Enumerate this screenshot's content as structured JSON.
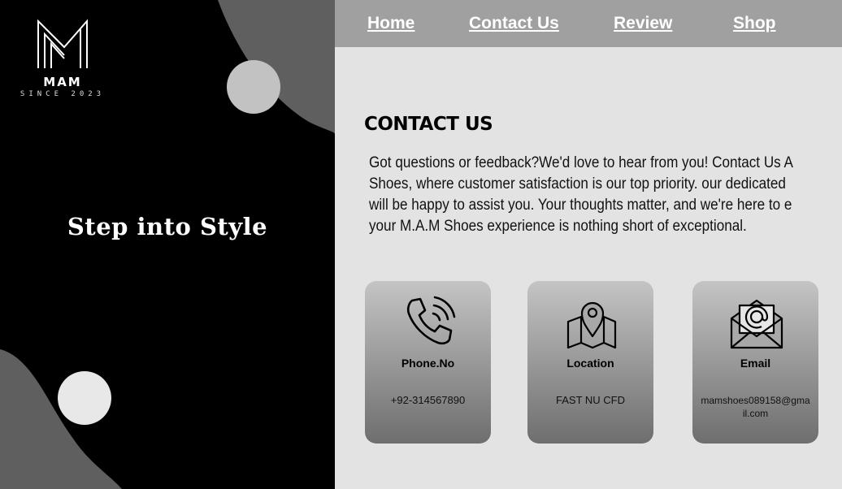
{
  "brand": {
    "name": "MAM",
    "since": "SINCE 2023"
  },
  "hero": {
    "tagline": "Step into Style"
  },
  "nav": {
    "items": [
      "Home",
      "Contact Us",
      "Review",
      "Shop"
    ]
  },
  "contact": {
    "title": "CONTACT US",
    "lines": [
      "Got questions or feedback?We'd love to hear from you! Contact Us A",
      "Shoes, where customer satisfaction is our top priority. our dedicated",
      "will be happy to assist you. Your thoughts matter, and we're here to e",
      "your M.A.M Shoes experience is nothing short of exceptional."
    ]
  },
  "cards": [
    {
      "icon": "phone-icon",
      "title": "Phone.No",
      "value": "+92-314567890"
    },
    {
      "icon": "location-map-icon",
      "title": "Location",
      "value": "FAST NU CFD"
    },
    {
      "icon": "email-envelope-icon",
      "title": "Email",
      "value": "mamshoes089158@gmail.com"
    }
  ],
  "colors": {
    "panel": "#000000",
    "decor": "#5f5f5f",
    "dot": "#c2c2c2",
    "nav": "#a0a0a0",
    "content": "#e3e3e3"
  }
}
